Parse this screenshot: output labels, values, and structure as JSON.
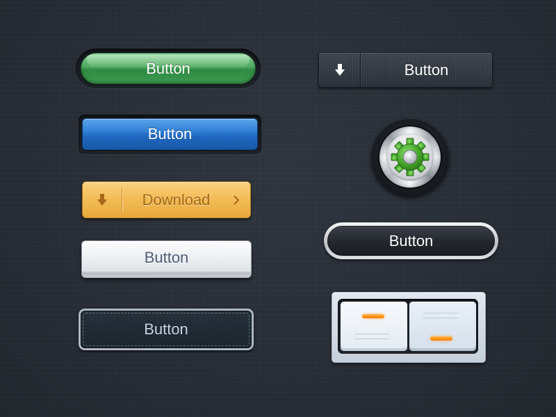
{
  "left_column": {
    "green_button": {
      "label": "Button",
      "color": "#4ea85f"
    },
    "blue_button": {
      "label": "Button",
      "color": "#2f7fd6"
    },
    "download_button": {
      "label": "Download",
      "icon": "download-arrow-icon",
      "trailing_icon": "chevron-right-icon",
      "color": "#f2bb55"
    },
    "light_button": {
      "label": "Button",
      "color": "#eceef1"
    },
    "denim_button": {
      "label": "Button",
      "color": "#24303b"
    }
  },
  "right_column": {
    "dark_split_button": {
      "label": "Button",
      "icon": "download-arrow-icon",
      "color": "#3d444d"
    },
    "gear_knob": {
      "icon": "gear-icon",
      "icon_color": "#3e9a2a"
    },
    "dark_pill_button": {
      "label": "Button",
      "color": "#23272d"
    },
    "toggle_switch": {
      "accent": "#ff8a00"
    }
  }
}
